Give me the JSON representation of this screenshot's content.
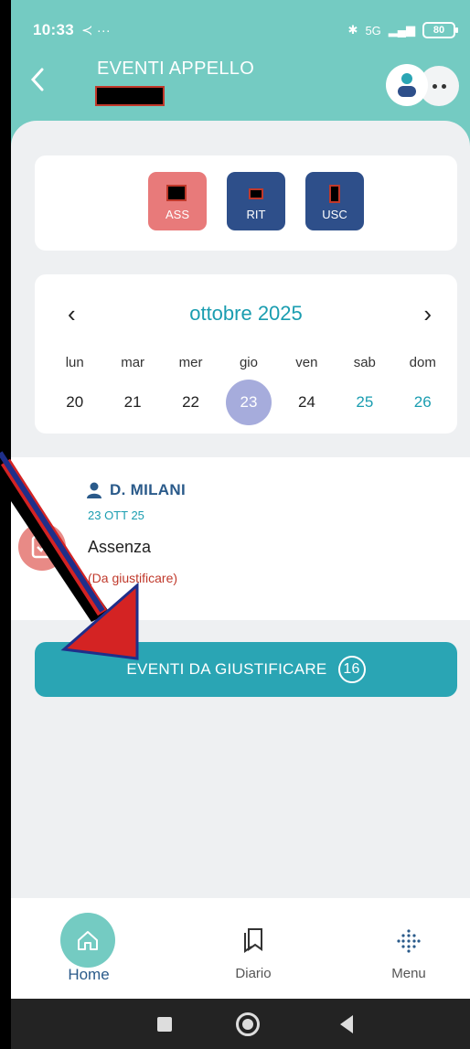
{
  "status_bar": {
    "time": "10:33",
    "extras": "≺ ···",
    "network": "5G",
    "battery": "80"
  },
  "header": {
    "title": "EVENTI APPELLO",
    "back_icon": "chevron-left-icon"
  },
  "event_types": [
    {
      "label": "ASS",
      "color": "#e87a7a"
    },
    {
      "label": "RIT",
      "color": "#2e4f8a"
    },
    {
      "label": "USC",
      "color": "#2e4f8a"
    }
  ],
  "calendar": {
    "month": "ottobre 2025",
    "prev": "‹",
    "next": "›",
    "weekdays": [
      "lun",
      "mar",
      "mer",
      "gio",
      "ven",
      "sab",
      "dom"
    ],
    "days": [
      "20",
      "21",
      "22",
      "23",
      "24",
      "25",
      "26"
    ],
    "selected_day": "23"
  },
  "event": {
    "person": "D. MILANI",
    "date": "23 OTT 25",
    "type": "Assenza",
    "status": "(Da giustificare)"
  },
  "justify_button": {
    "label": "EVENTI DA GIUSTIFICARE",
    "count": "16"
  },
  "bottom_nav": [
    {
      "label": "Home",
      "icon": "home-icon",
      "active": true
    },
    {
      "label": "Diario",
      "icon": "bookmarks-icon",
      "active": false
    },
    {
      "label": "Menu",
      "icon": "dots-grid-icon",
      "active": false
    }
  ],
  "colors": {
    "header": "#74cbc2",
    "accent": "#1a9db0",
    "button": "#2aa5b4",
    "danger": "#c0392b"
  }
}
